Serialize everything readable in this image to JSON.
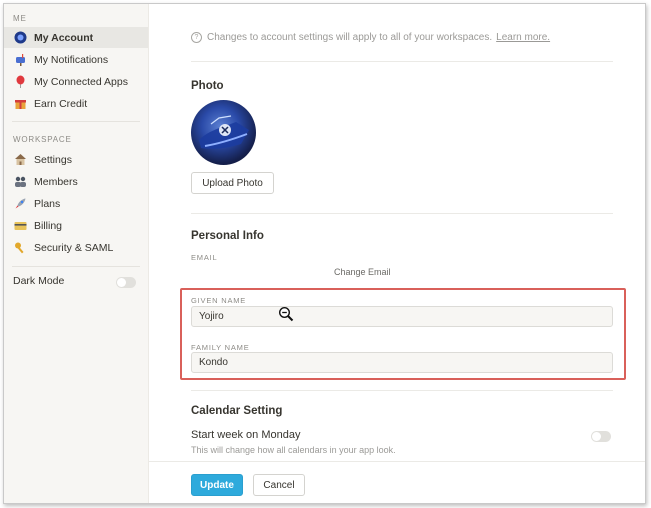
{
  "sidebar": {
    "me_header": "ME",
    "me_items": [
      {
        "label": "My Account",
        "icon": "user-globe-icon"
      },
      {
        "label": "My Notifications",
        "icon": "mailbox-icon"
      },
      {
        "label": "My Connected Apps",
        "icon": "balloon-icon"
      },
      {
        "label": "Earn Credit",
        "icon": "gift-icon"
      }
    ],
    "workspace_header": "WORKSPACE",
    "workspace_items": [
      {
        "label": "Settings",
        "icon": "house-icon"
      },
      {
        "label": "Members",
        "icon": "people-icon"
      },
      {
        "label": "Plans",
        "icon": "rocket-icon"
      },
      {
        "label": "Billing",
        "icon": "credit-card-icon"
      },
      {
        "label": "Security & SAML",
        "icon": "key-icon"
      }
    ],
    "dark_mode_label": "Dark Mode"
  },
  "main": {
    "notice_text": "Changes to account settings will apply to all of your workspaces.",
    "notice_link": "Learn more.",
    "photo_heading": "Photo",
    "upload_button": "Upload Photo",
    "personal_heading": "Personal Info",
    "email_label": "EMAIL",
    "change_email": "Change Email",
    "given_name_label": "GIVEN NAME",
    "given_name_value": "Yojiro",
    "family_name_label": "FAMILY NAME",
    "family_name_value": "Kondo",
    "calendar_heading": "Calendar Setting",
    "start_week_label": "Start week on Monday",
    "start_week_sub": "This will change how all calendars in your app look."
  },
  "footer": {
    "update_button": "Update",
    "cancel_button": "Cancel"
  },
  "colors": {
    "accent": "#2eaadc",
    "highlight": "#d9605a"
  }
}
